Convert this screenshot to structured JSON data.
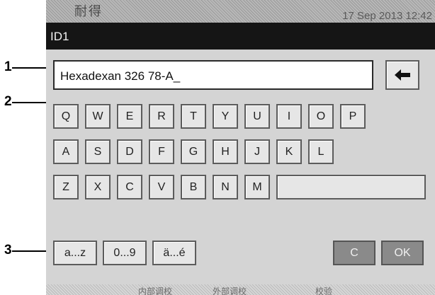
{
  "callouts": [
    "1",
    "2",
    "3"
  ],
  "status": {
    "logo_text": "耐得",
    "datetime": "17 Sep 2013  12:42"
  },
  "title": "ID1",
  "input": {
    "value": "Hexadexan 326 78-A_"
  },
  "backspace": {
    "icon": "backspace-arrow-icon"
  },
  "keyboard": {
    "row1": [
      "Q",
      "W",
      "E",
      "R",
      "T",
      "Y",
      "U",
      "I",
      "O",
      "P"
    ],
    "row2": [
      "A",
      "S",
      "D",
      "F",
      "G",
      "H",
      "J",
      "K",
      "L"
    ],
    "row3": [
      "Z",
      "X",
      "C",
      "V",
      "B",
      "N",
      "M"
    ]
  },
  "modes": [
    "a...z",
    "0...9",
    "ä...é"
  ],
  "actions": {
    "clear": "C",
    "ok": "OK"
  },
  "footer": [
    "内部调校",
    "外部调校",
    "校验"
  ]
}
